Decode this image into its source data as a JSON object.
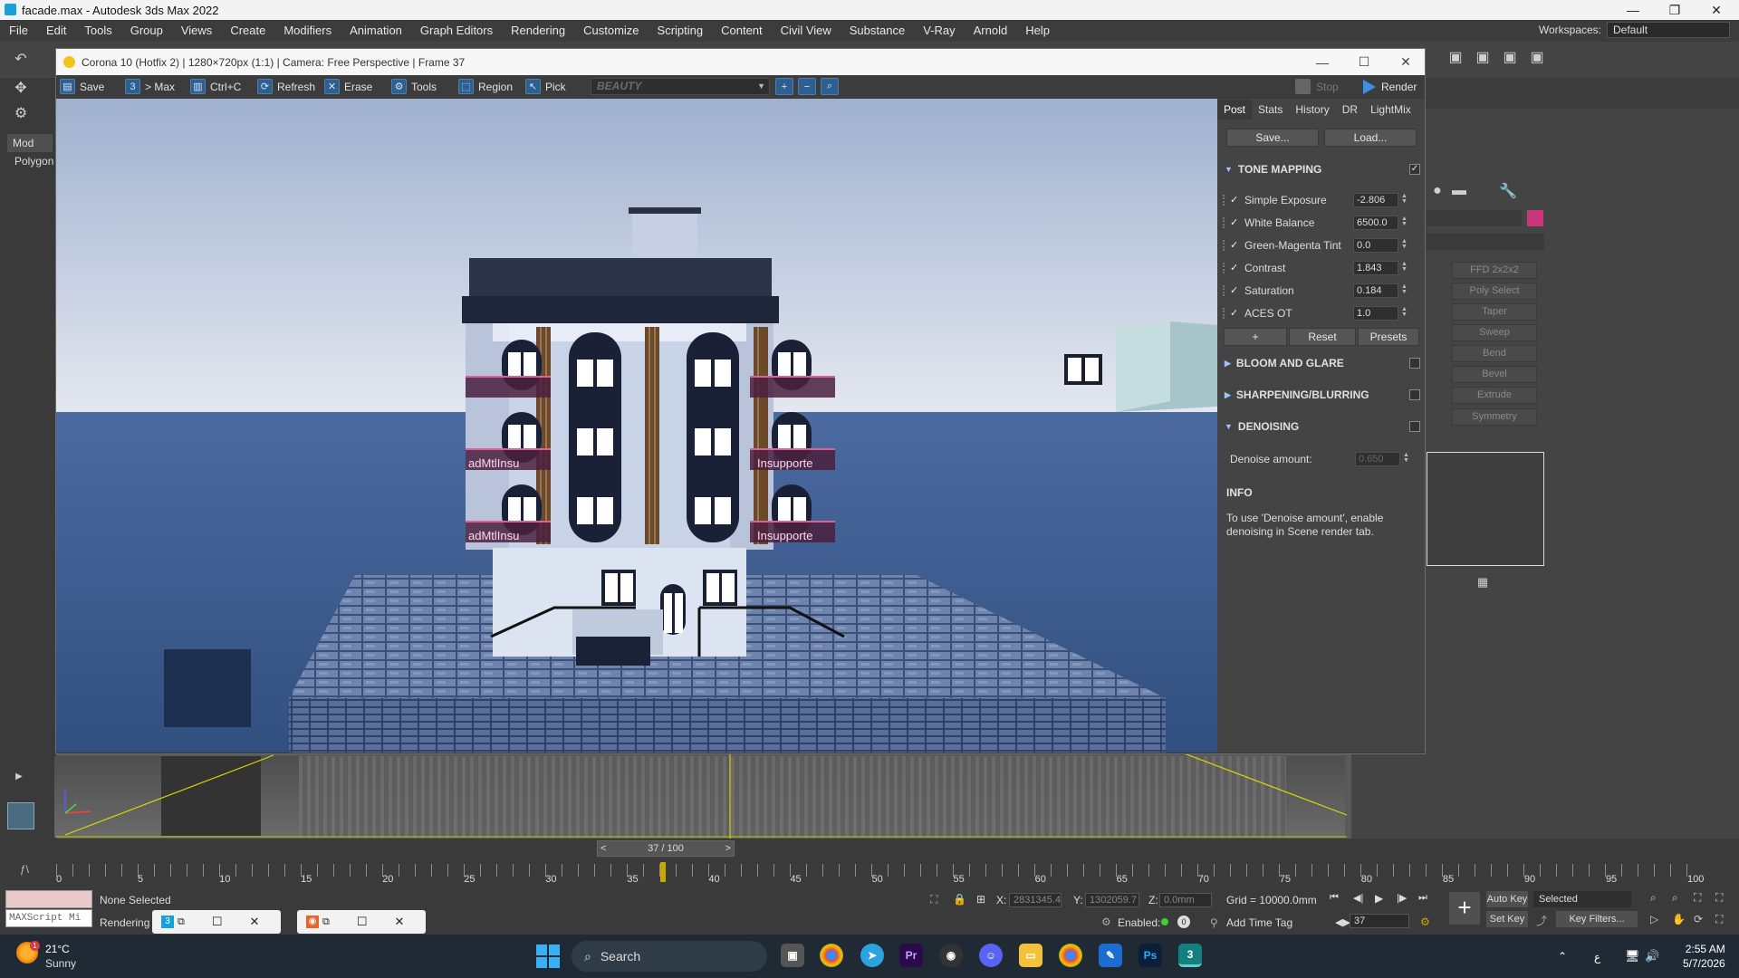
{
  "app": {
    "title": "facade.max - Autodesk 3ds Max 2022",
    "menu": [
      "File",
      "Edit",
      "Tools",
      "Group",
      "Views",
      "Create",
      "Modifiers",
      "Animation",
      "Graph Editors",
      "Rendering",
      "Customize",
      "Scripting",
      "Content",
      "Civil View",
      "Substance",
      "V-Ray",
      "Arnold",
      "Help"
    ],
    "workspaces_label": "Workspaces:",
    "workspace_value": "Default"
  },
  "left_strip": {
    "mod_label": "Mod",
    "polygon_label": "Polygon"
  },
  "command_panel": {
    "modifier_buttons": [
      "FFD 2x2x2",
      "Poly Select",
      "Taper",
      "Sweep",
      "Bend",
      "Bevel",
      "Extrude",
      "Symmetry"
    ],
    "swatch_color": "#c8357a"
  },
  "vfb": {
    "title": "Corona 10 (Hotfix 2) | 1280×720px (1:1) | Camera: Free Perspective | Frame 37",
    "toolbar": {
      "save": "Save",
      "to_max": "> Max",
      "ctrl_c": "Ctrl+C",
      "refresh": "Refresh",
      "erase": "Erase",
      "tools": "Tools",
      "region": "Region",
      "pick": "Pick",
      "channel": "BEAUTY",
      "stop": "Stop",
      "render": "Render"
    },
    "tabs": [
      "Post",
      "Stats",
      "History",
      "DR",
      "LightMix"
    ],
    "active_tab": "Post",
    "save_btn": "Save...",
    "load_btn": "Load...",
    "tone_mapping": {
      "header": "TONE MAPPING",
      "rows": [
        {
          "label": "Simple Exposure",
          "value": "-2.806"
        },
        {
          "label": "White Balance",
          "value": "6500.0"
        },
        {
          "label": "Green-Magenta Tint",
          "value": "0.0"
        },
        {
          "label": "Contrast",
          "value": "1.843"
        },
        {
          "label": "Saturation",
          "value": "0.184"
        },
        {
          "label": "ACES OT",
          "value": "1.0"
        }
      ],
      "plus": "+",
      "reset": "Reset",
      "presets": "Presets"
    },
    "bloom_glare": "BLOOM AND GLARE",
    "sharpening": "SHARPENING/BLURRING",
    "denoising": {
      "header": "DENOISING",
      "amount_label": "Denoise amount:",
      "amount_value": "0.650"
    },
    "info": {
      "header": "INFO",
      "text": "To use 'Denoise amount', enable denoising in Scene render tab."
    }
  },
  "timeline": {
    "slider_label": "37 / 100",
    "current_frame": 37,
    "total_frames": 100,
    "ticks": [
      "0",
      "5",
      "10",
      "15",
      "20",
      "25",
      "30",
      "35",
      "40",
      "45",
      "50",
      "55",
      "60",
      "65",
      "70",
      "75",
      "80",
      "85",
      "90",
      "95",
      "100"
    ]
  },
  "status": {
    "maxscript": "MAXScript Mi",
    "selection": "None Selected",
    "rendering": "Rendering T",
    "x_label": "X:",
    "x_value": "2831345.4",
    "y_label": "Y:",
    "y_value": "1302059.7",
    "z_label": "Z:",
    "z_value": "0.0mm",
    "grid": "Grid = 10000.0mm",
    "enabled": "Enabled:",
    "add_time_tag": "Add Time Tag",
    "auto_key": "Auto Key",
    "set_key": "Set Key",
    "selected": "Selected",
    "key_filters": "Key Filters...",
    "frame_field": "37"
  },
  "taskbar": {
    "weather_temp": "21°C",
    "weather_cond": "Sunny",
    "weather_badge": "1",
    "search": "Search",
    "time": "2:55 AM",
    "date": "5/7/2026",
    "lang": "ع"
  },
  "scene": {
    "balcony_text_left": "adMtlInsu",
    "balcony_text_right": "Insupporte"
  }
}
